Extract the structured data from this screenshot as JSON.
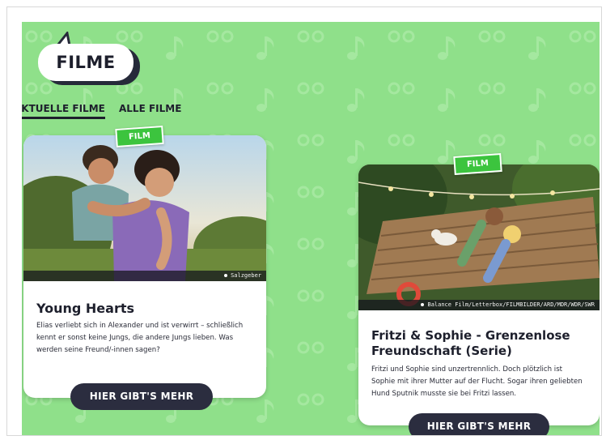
{
  "page": {
    "title": "FILME"
  },
  "tabs": [
    {
      "label": "AKTUELLE FILME",
      "active": true
    },
    {
      "label": "ALLE FILME",
      "active": false
    }
  ],
  "cards": [
    {
      "badge": "FILM",
      "title": "Young Hearts",
      "description": "Elias verliebt sich in Alexander und ist verwirrt – schließlich kennt er sonst keine Jungs, die andere Jungs lieben. Was werden seine Freund/-innen sagen?",
      "credit": "Salzgeber",
      "cta": "HIER GIBT'S MEHR"
    },
    {
      "badge": "FILM",
      "title": "Fritzi & Sophie - Grenzenlose Freundschaft (Serie)",
      "description": "Fritzi und Sophie sind unzertrennlich. Doch plötzlich ist Sophie mit ihrer Mutter auf der Flucht. Sogar ihren geliebten Hund Sputnik musste sie bei Fritzi lassen.",
      "credit": "Balance Film/Letterbox/FILMBILDER/ARD/MDR/WDR/SWR",
      "cta": "HIER GIBT'S MEHR"
    }
  ],
  "colors": {
    "background": "#8fe08a",
    "badge": "#3cc43e",
    "dark": "#2b2d3f"
  }
}
